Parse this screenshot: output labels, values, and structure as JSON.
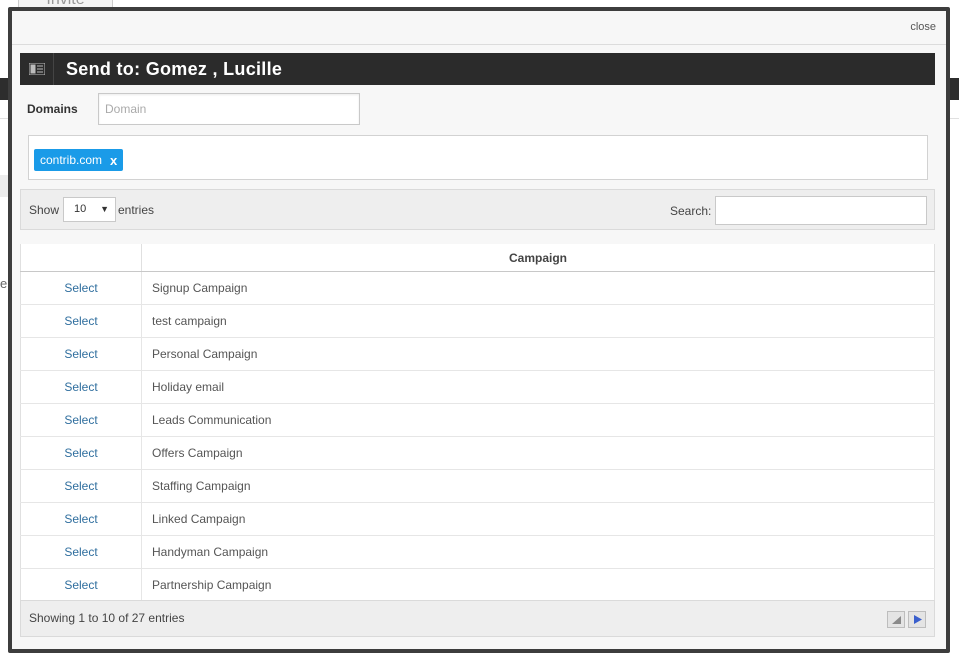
{
  "background": {
    "tab_label": "Invite"
  },
  "modal": {
    "close_label": "close",
    "title": "Send to: Gomez , Lucille"
  },
  "domains": {
    "label": "Domains",
    "placeholder": "Domain",
    "tags": [
      {
        "label": "contrib.com",
        "remove": "x"
      }
    ]
  },
  "toolbar": {
    "show_label": "Show",
    "page_length": "10",
    "entries_label": "entries",
    "search_label": "Search:"
  },
  "table": {
    "columns": [
      "",
      "Campaign"
    ],
    "rows": [
      {
        "action": "Select",
        "campaign": "Signup Campaign"
      },
      {
        "action": "Select",
        "campaign": "test campaign"
      },
      {
        "action": "Select",
        "campaign": "Personal Campaign"
      },
      {
        "action": "Select",
        "campaign": "Holiday email"
      },
      {
        "action": "Select",
        "campaign": "Leads Communication"
      },
      {
        "action": "Select",
        "campaign": "Offers Campaign"
      },
      {
        "action": "Select",
        "campaign": "Staffing Campaign"
      },
      {
        "action": "Select",
        "campaign": "Linked Campaign"
      },
      {
        "action": "Select",
        "campaign": "Handyman Campaign"
      },
      {
        "action": "Select",
        "campaign": "Partnership Campaign"
      }
    ]
  },
  "footer": {
    "info": "Showing 1 to 10 of 27 entries"
  },
  "colors": {
    "accent": "#1a9be8",
    "titlebar": "#2b2b2b",
    "link": "#2f6e9e"
  }
}
